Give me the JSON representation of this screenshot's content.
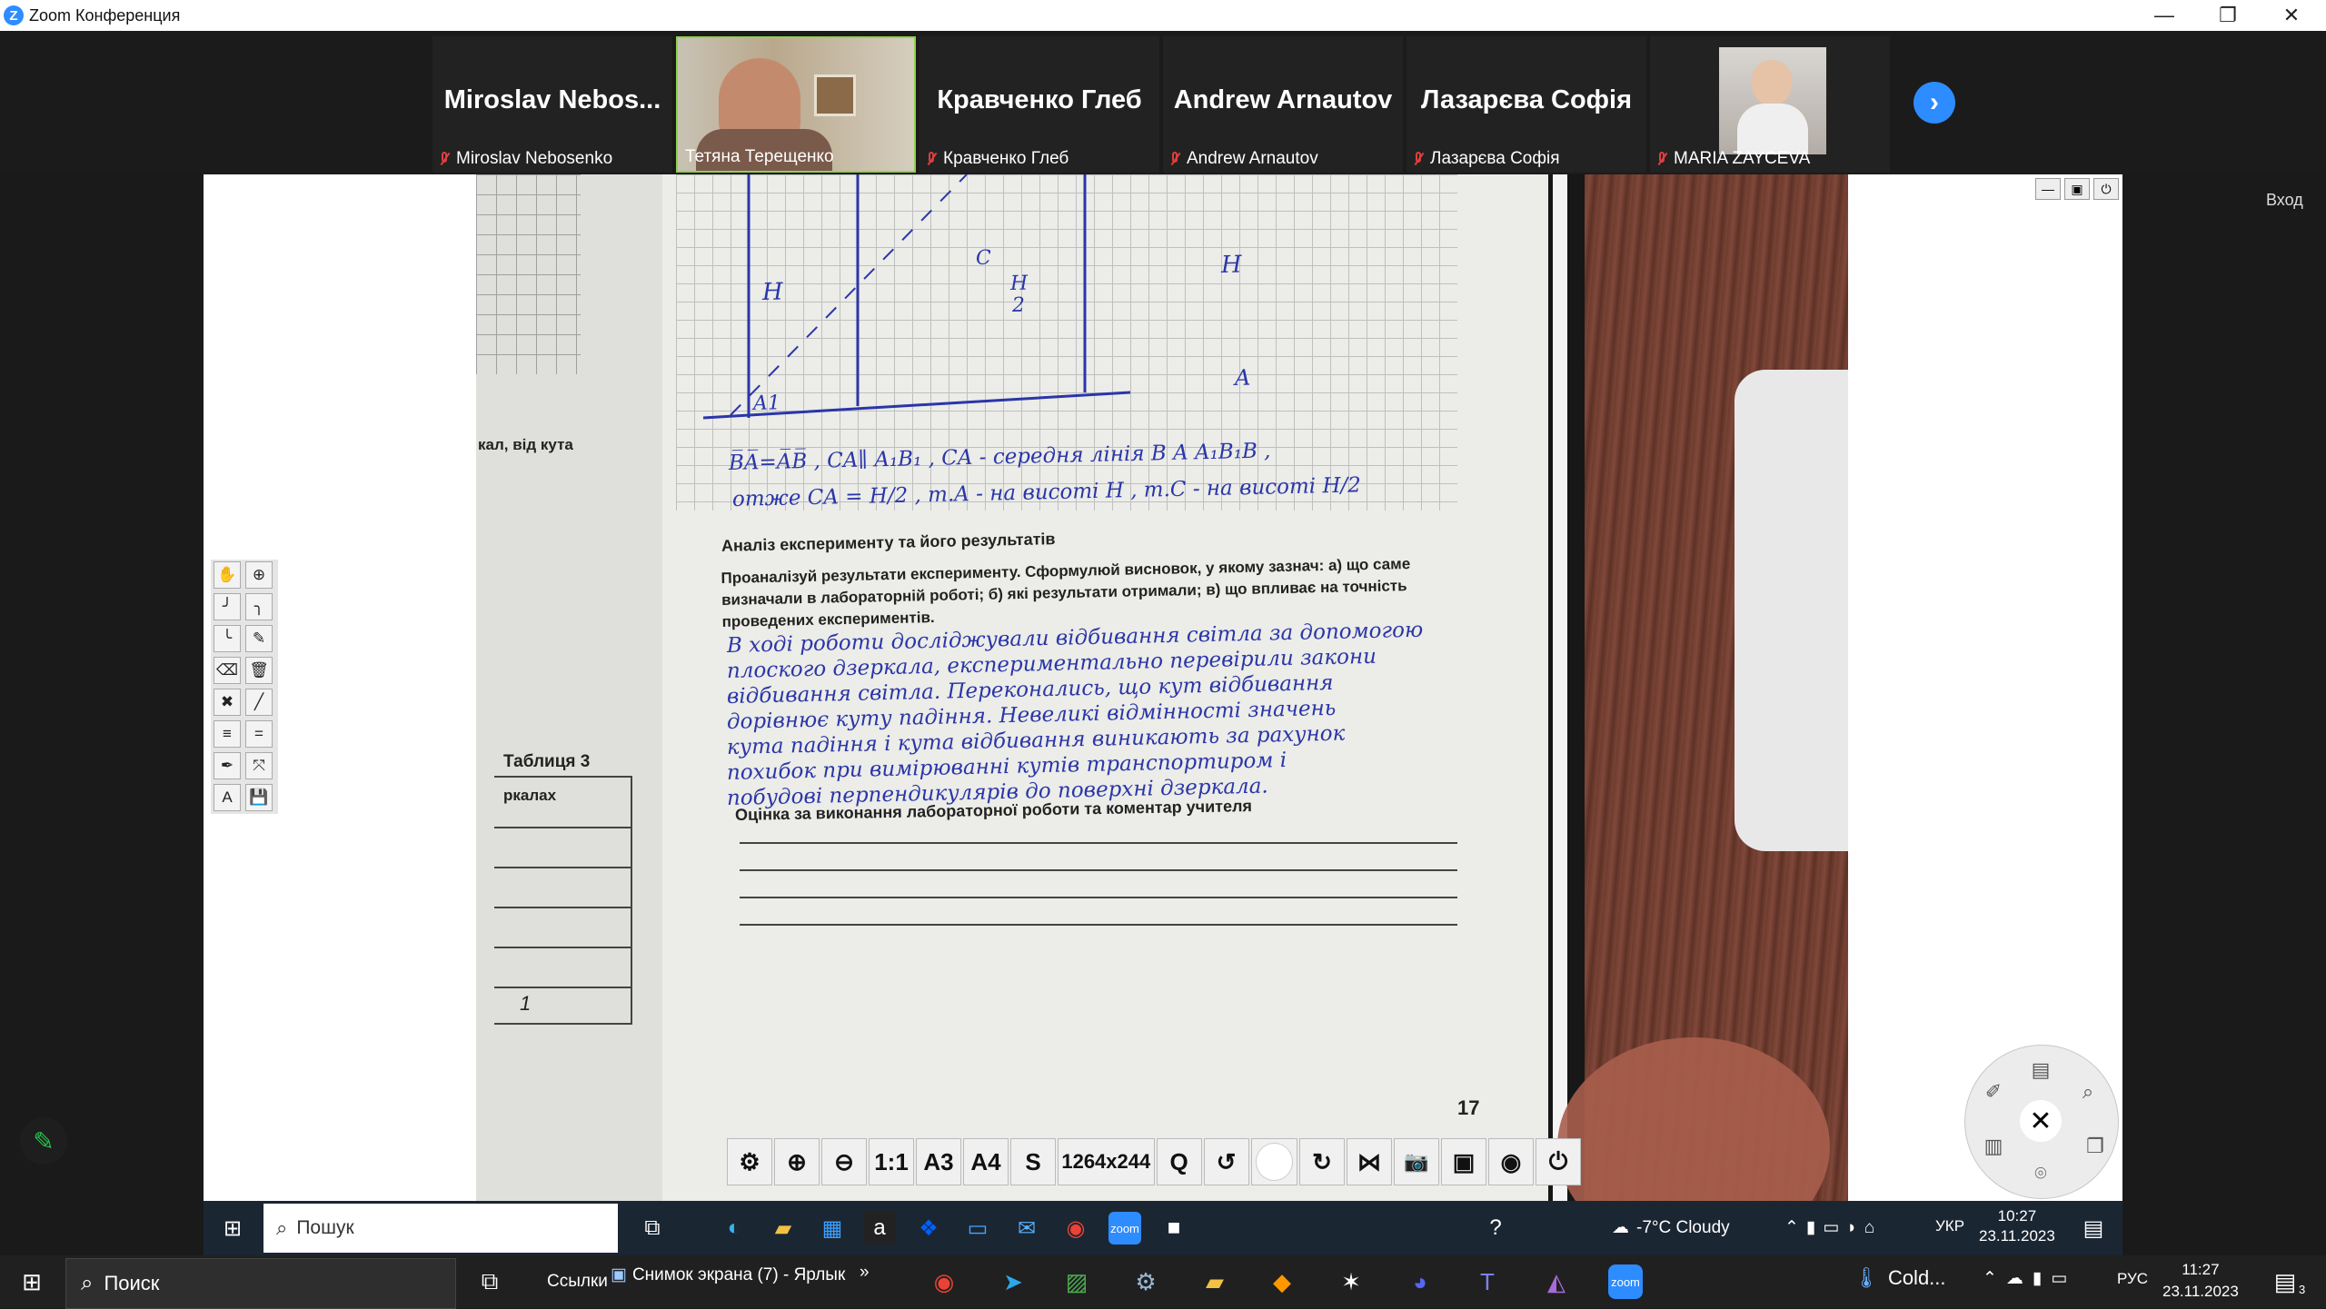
{
  "window": {
    "title": "Zoom Конференция"
  },
  "participants": [
    {
      "big": "Miroslav  Nebos...",
      "name": "Miroslav Nebosenko"
    },
    {
      "big": "",
      "name": "Тетяна Терещенко"
    },
    {
      "big": "Кравченко Глеб",
      "name": "Кравченко Глеб"
    },
    {
      "big": "Andrew Arnautov",
      "name": "Andrew Arnautov"
    },
    {
      "big": "Лазарєва Софія",
      "name": "Лазарєва Софія"
    },
    {
      "big": "",
      "name": "MARIA ZAYCEVA"
    }
  ],
  "share": {
    "side_hint": "Вход"
  },
  "doc": {
    "left_text": "кал, від кута",
    "left_table_title": "Таблиця 3",
    "left_table_head": "ркалах",
    "left_page_num": "1",
    "grid_labels": [
      "H",
      "H",
      "A1",
      "A",
      "C",
      "H",
      "2"
    ],
    "formula_line1": "B̅A̅=A̅B̅ ,  CA∥ A₁B₁ ,  CA - середня лінія  B A A₁B₁B ,",
    "formula_line2": "отже   CA = H/2  ,  т.A - на висоті H ,   т.C - на висоті H/2",
    "section_title": "Аналіз експерименту та його результатів",
    "instructions": [
      "Проаналізуй результати експерименту. Сформулюй висновок, у якому зазнач: а) що саме",
      "визначали в лабораторній роботі; б) які результати отримали; в) що впливає на точність",
      "проведених експериментів."
    ],
    "handwriting": [
      "В ході роботи досліджували відбивання світла за допомогою",
      "плоского дзеркала, експериментально перевірили закони",
      "відбивання світла. Переконались, що кут відбивання",
      "дорівнює куту падіння. Невеликі відмінності значень",
      "кута падіння і кута відбивання виникають за рахунок",
      "похибок при вимірюванні кутів транспортиром і",
      "побудові перпендикулярів до поверхні дзеркала."
    ],
    "grade_title": "Оцінка за виконання лабораторної роботи та коментар учителя",
    "page_number": "17"
  },
  "viewer_toolbar": [
    {
      "name": "settings-icon",
      "label": "⚙"
    },
    {
      "name": "zoom-in-icon",
      "label": "⊕"
    },
    {
      "name": "zoom-out-icon",
      "label": "⊖"
    },
    {
      "name": "one-to-one",
      "label": "1:1"
    },
    {
      "name": "a3",
      "label": "A3"
    },
    {
      "name": "a4",
      "label": "A4"
    },
    {
      "name": "s",
      "label": "S"
    },
    {
      "name": "resolution",
      "label": "1264x244"
    },
    {
      "name": "q",
      "label": "Q"
    },
    {
      "name": "rotate-left-icon",
      "label": "↺"
    },
    {
      "name": "record-icon",
      "label": ""
    },
    {
      "name": "rotate-right-icon",
      "label": "↻"
    },
    {
      "name": "mirror-icon",
      "label": "⋈"
    },
    {
      "name": "camera-icon",
      "label": "📷"
    },
    {
      "name": "video-icon",
      "label": "▣"
    },
    {
      "name": "webcam-icon",
      "label": "◉"
    },
    {
      "name": "power-icon",
      "label": "⏻"
    }
  ],
  "inner_taskbar": {
    "search": "Пошук",
    "weather": "-7°C  Cloudy",
    "lang": "УКР",
    "time": "10:27",
    "date": "23.11.2023"
  },
  "main_taskbar": {
    "search": "Поиск",
    "links": "Ссылки",
    "shortcut": "Снимок экрана (7) - Ярлык",
    "weather": "Cold...",
    "lang": "РУС",
    "time": "11:27",
    "date": "23.11.2023",
    "notif_count": "3"
  },
  "colors": {
    "zoom_blue": "#2d8cff",
    "ink": "#2a36a8",
    "mic_muted": "#e03e3e"
  }
}
